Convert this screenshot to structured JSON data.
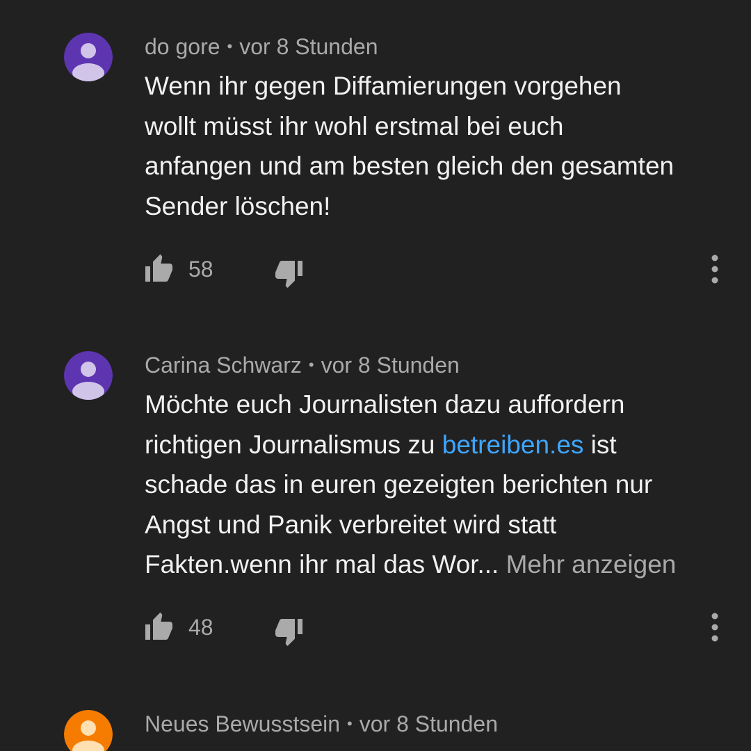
{
  "comments": [
    {
      "author": "do gore",
      "separator": "•",
      "time": "vor 8 Stunden",
      "avatar_color": "#5e35b1",
      "lines": [
        "Wenn ihr gegen Diffamierungen vorgehen",
        "wollt müsst ihr wohl erstmal bei euch",
        "anfangen und am besten gleich den gesamten",
        "Sender löschen!"
      ],
      "likes": "58"
    },
    {
      "author": "Carina Schwarz",
      "separator": "•",
      "time": "vor 8 Stunden",
      "avatar_color": "#5e35b1",
      "lines": [
        "Möchte euch Journalisten dazu auffordern",
        "schade das in euren gezeigten berichten nur",
        "Angst und Panik verbreitet wird statt"
      ],
      "line2_before_link": "richtigen Journalismus zu ",
      "line2_link": "betreiben.es",
      "line2_after_link": " ist",
      "last_line": "Fakten.wenn ihr mal das Wor...",
      "more_label": "Mehr anzeigen",
      "likes": "48"
    },
    {
      "author": "Neues Bewusstsein",
      "separator": "•",
      "time": "vor 8 Stunden",
      "avatar_color": "#f57c00"
    }
  ],
  "icons": {
    "like": "thumb-up-icon",
    "dislike": "thumb-down-icon",
    "menu": "more-vert-icon",
    "avatar": "default-user-avatar-icon"
  },
  "colors": {
    "background": "#212121",
    "text": "#f1f1f1",
    "secondary": "#aaaaaa",
    "link": "#3ea6ff"
  }
}
